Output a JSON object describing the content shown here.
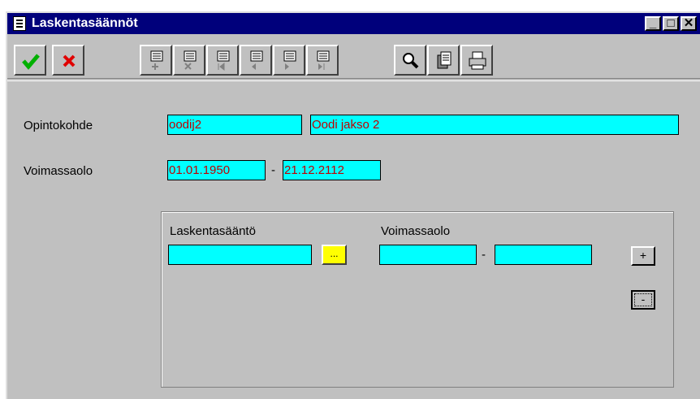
{
  "window": {
    "title": "Laskentasäännöt",
    "minimize": "_",
    "maximize": "□",
    "close": "✕"
  },
  "form": {
    "opintokohde_label": "Opintokohde",
    "opintokohde_code": "oodij2",
    "opintokohde_name": "Oodi jakso 2",
    "voimassaolo_label": "Voimassaolo",
    "voimassaolo_start": "01.01.1950",
    "voimassaolo_end": "21.12.2112",
    "dash": "-"
  },
  "panel": {
    "rule_label": "Laskentasääntö",
    "rule_value": "",
    "browse_label": "...",
    "validity_label": "Voimassaolo",
    "validity_start": "",
    "validity_end": "",
    "dash": "-",
    "add_label": "+",
    "remove_label": "-"
  }
}
